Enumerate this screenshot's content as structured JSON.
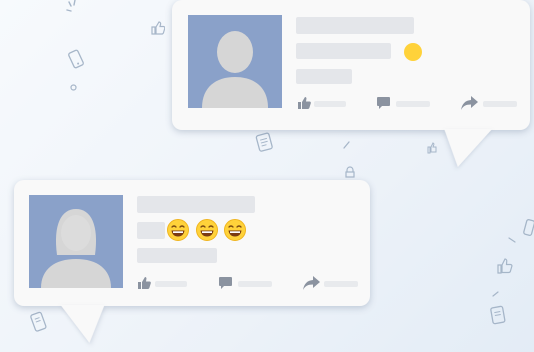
{
  "posts": [
    {
      "id": "post-top",
      "avatar": "male-silhouette",
      "reaction_icons": [
        "yellow-dot-icon"
      ],
      "actions": [
        "like-icon",
        "comment-icon",
        "share-icon"
      ]
    },
    {
      "id": "post-bottom",
      "avatar": "female-silhouette",
      "reaction_icons": [
        "laughing-emoji-icon",
        "laughing-emoji-icon",
        "laughing-emoji-icon"
      ],
      "actions": [
        "like-icon",
        "comment-icon",
        "share-icon"
      ]
    }
  ],
  "colors": {
    "background": "#eef3f9",
    "bubble": "#f9f9f9",
    "avatar_bg": "#8aa1c9",
    "silhouette": "#d6d6d6",
    "placeholder": "#e4e6ea",
    "emoji": "#ffd23a"
  }
}
